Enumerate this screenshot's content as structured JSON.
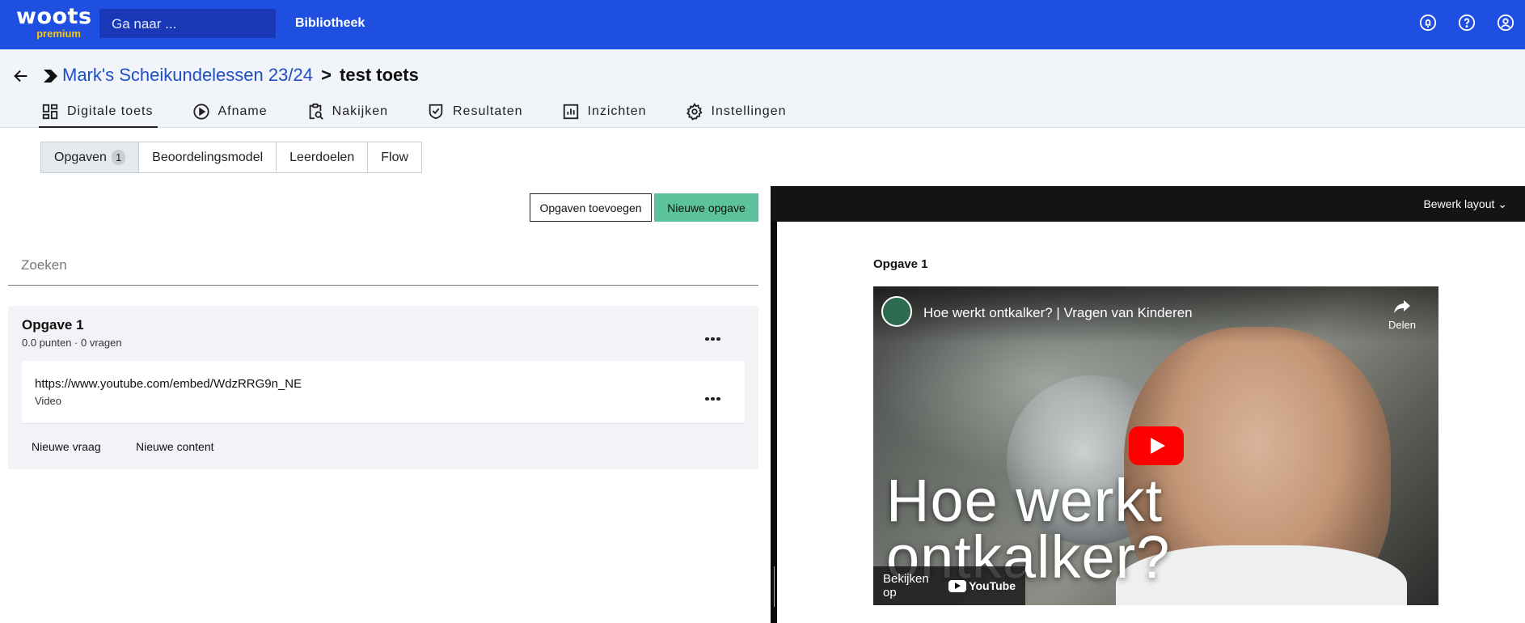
{
  "topbar": {
    "logo_word": "woots",
    "logo_sub": "premium",
    "goto_placeholder": "Ga naar ...",
    "library_label": "Bibliotheek",
    "icons": [
      "notifications-icon",
      "help-icon",
      "account-icon"
    ]
  },
  "header": {
    "breadcrumb_link": "Mark's Scheikundelessen 23/24",
    "breadcrumb_sep": ">",
    "breadcrumb_current": "test toets"
  },
  "tabs": [
    {
      "label": "Digitale toets",
      "icon": "grid-icon",
      "active": true
    },
    {
      "label": "Afname",
      "icon": "play-circle-icon",
      "active": false
    },
    {
      "label": "Nakijken",
      "icon": "clipboard-search-icon",
      "active": false
    },
    {
      "label": "Resultaten",
      "icon": "badge-check-icon",
      "active": false
    },
    {
      "label": "Inzichten",
      "icon": "bar-chart-icon",
      "active": false
    },
    {
      "label": "Instellingen",
      "icon": "gear-icon",
      "active": false
    }
  ],
  "subtabs": [
    {
      "label": "Opgaven",
      "count": "1",
      "active": true
    },
    {
      "label": "Beoordelingsmodel"
    },
    {
      "label": "Leerdoelen"
    },
    {
      "label": "Flow"
    }
  ],
  "actions": {
    "add_label": "Opgaven toevoegen",
    "new_label": "Nieuwe opgave"
  },
  "search": {
    "placeholder": "Zoeken"
  },
  "opgave": {
    "title": "Opgave 1",
    "meta": "0.0 punten · 0 vragen",
    "item_url": "https://www.youtube.com/embed/WdzRRG9n_NE",
    "item_type": "Video",
    "new_question": "Nieuwe vraag",
    "new_content": "Nieuwe content"
  },
  "preview": {
    "layout_label": "Bewerk layout",
    "title": "Opgave 1",
    "video_title": "Hoe werkt ontkalker? | Vragen van Kinderen",
    "share_label": "Delen",
    "overlay_line1": "Hoe werkt",
    "overlay_line2": "ontkalker?",
    "watch_label": "Bekijken op",
    "youtube_label": "YouTube"
  }
}
